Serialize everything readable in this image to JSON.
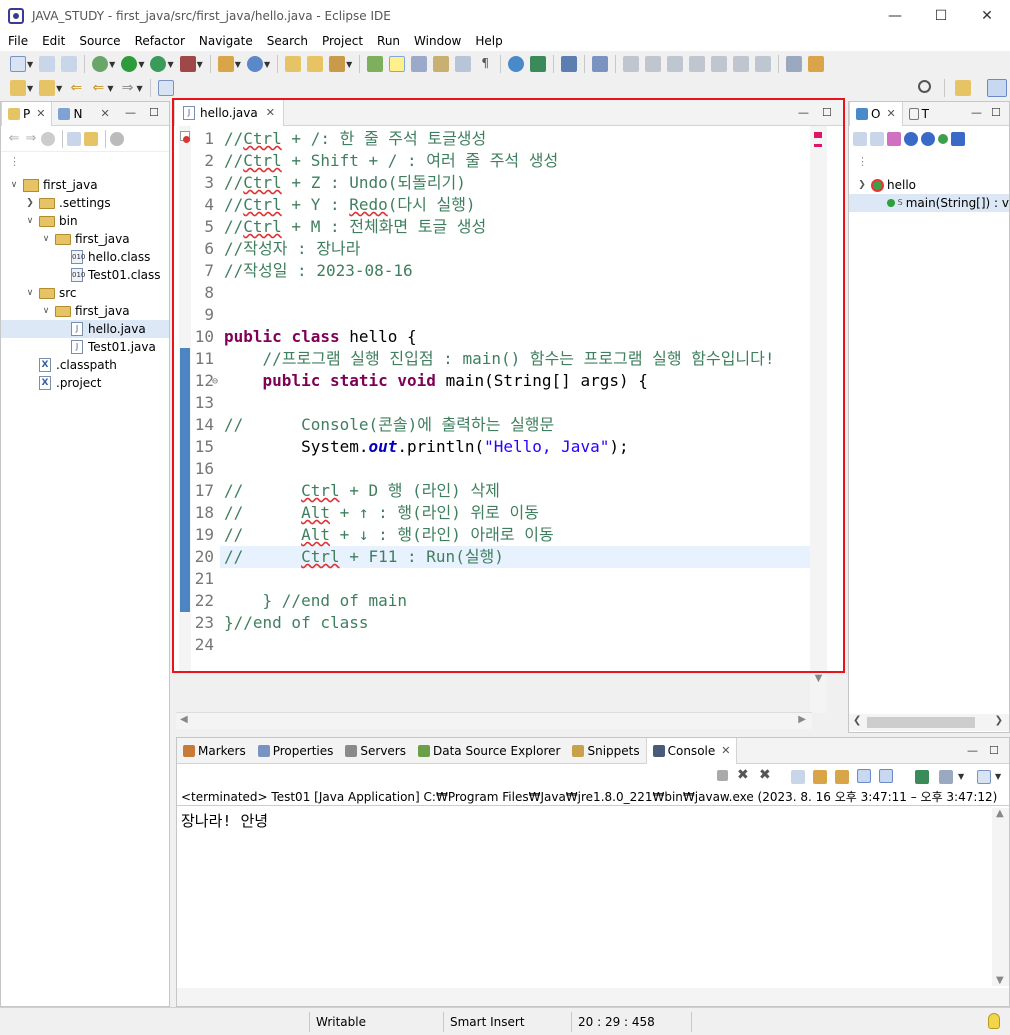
{
  "window": {
    "title": "JAVA_STUDY - first_java/src/first_java/hello.java - Eclipse IDE"
  },
  "menu": [
    "File",
    "Edit",
    "Source",
    "Refactor",
    "Navigate",
    "Search",
    "Project",
    "Run",
    "Window",
    "Help"
  ],
  "left_panel": {
    "tabs": [
      "P",
      "N"
    ],
    "tree": [
      {
        "label": "first_java",
        "type": "project",
        "depth": 0,
        "expanded": true
      },
      {
        "label": ".settings",
        "type": "folder",
        "depth": 1,
        "expanded": false
      },
      {
        "label": "bin",
        "type": "folder",
        "depth": 1,
        "expanded": true
      },
      {
        "label": "first_java",
        "type": "folder",
        "depth": 2,
        "expanded": true
      },
      {
        "label": "hello.class",
        "type": "class",
        "depth": 3
      },
      {
        "label": "Test01.class",
        "type": "class",
        "depth": 3
      },
      {
        "label": "src",
        "type": "folder",
        "depth": 1,
        "expanded": true
      },
      {
        "label": "first_java",
        "type": "folder",
        "depth": 2,
        "expanded": true
      },
      {
        "label": "hello.java",
        "type": "java",
        "depth": 3,
        "selected": true
      },
      {
        "label": "Test01.java",
        "type": "java",
        "depth": 3
      },
      {
        "label": ".classpath",
        "type": "xml",
        "depth": 1
      },
      {
        "label": ".project",
        "type": "xml",
        "depth": 1
      }
    ]
  },
  "editor": {
    "tab": "hello.java",
    "lines": [
      {
        "n": "1",
        "segs": [
          {
            "t": "//",
            "c": "cm"
          },
          {
            "t": "Ctrl",
            "c": "cm ul"
          },
          {
            "t": " + /: 한 줄 주석 토글생성",
            "c": "cm"
          }
        ]
      },
      {
        "n": "2",
        "segs": [
          {
            "t": "//",
            "c": "cm"
          },
          {
            "t": "Ctrl",
            "c": "cm ul"
          },
          {
            "t": " + Shift + / : 여러 줄 주석 생성",
            "c": "cm"
          }
        ]
      },
      {
        "n": "3",
        "segs": [
          {
            "t": "//",
            "c": "cm"
          },
          {
            "t": "Ctrl",
            "c": "cm ul"
          },
          {
            "t": " + Z : Undo(되돌리기)",
            "c": "cm"
          }
        ]
      },
      {
        "n": "4",
        "segs": [
          {
            "t": "//",
            "c": "cm"
          },
          {
            "t": "Ctrl",
            "c": "cm ul"
          },
          {
            "t": " + Y : ",
            "c": "cm"
          },
          {
            "t": "Redo",
            "c": "cm ul"
          },
          {
            "t": "(다시 실행)",
            "c": "cm"
          }
        ]
      },
      {
        "n": "5",
        "segs": [
          {
            "t": "//",
            "c": "cm"
          },
          {
            "t": "Ctrl",
            "c": "cm ul"
          },
          {
            "t": " + M : 전체화면 토글 생성",
            "c": "cm"
          }
        ]
      },
      {
        "n": "6",
        "segs": [
          {
            "t": "//작성자 : 장나라",
            "c": "cm"
          }
        ]
      },
      {
        "n": "7",
        "segs": [
          {
            "t": "//작성일 : 2023-08-16",
            "c": "cm"
          }
        ]
      },
      {
        "n": "8",
        "segs": []
      },
      {
        "n": "9",
        "segs": []
      },
      {
        "n": "10",
        "segs": [
          {
            "t": "public",
            "c": "kw"
          },
          {
            "t": " ",
            "c": "pl"
          },
          {
            "t": "class",
            "c": "kw"
          },
          {
            "t": " hello {",
            "c": "pl"
          }
        ]
      },
      {
        "n": "11",
        "segs": [
          {
            "t": "    //프로그램 실행 진입점 : main() 함수는 프로그램 실행 함수입니다!",
            "c": "cm"
          }
        ]
      },
      {
        "n": "12",
        "segs": [
          {
            "t": "    ",
            "c": "pl"
          },
          {
            "t": "public",
            "c": "kw"
          },
          {
            "t": " ",
            "c": "pl"
          },
          {
            "t": "static",
            "c": "kw"
          },
          {
            "t": " ",
            "c": "pl"
          },
          {
            "t": "void",
            "c": "kw"
          },
          {
            "t": " main(String[] ",
            "c": "pl"
          },
          {
            "t": "args",
            "c": "pl"
          },
          {
            "t": ") {",
            "c": "pl"
          }
        ]
      },
      {
        "n": "13",
        "segs": []
      },
      {
        "n": "14",
        "segs": [
          {
            "t": "//      Console(콘솔)에 출력하는 실행문",
            "c": "cm"
          }
        ]
      },
      {
        "n": "15",
        "segs": [
          {
            "t": "        System.",
            "c": "pl"
          },
          {
            "t": "out",
            "c": "fld"
          },
          {
            "t": ".println(",
            "c": "pl"
          },
          {
            "t": "\"Hello, Java\"",
            "c": "st"
          },
          {
            "t": ");",
            "c": "pl"
          }
        ]
      },
      {
        "n": "16",
        "segs": []
      },
      {
        "n": "17",
        "segs": [
          {
            "t": "//      ",
            "c": "cm"
          },
          {
            "t": "Ctrl",
            "c": "cm ul"
          },
          {
            "t": " + D 행 (라인) 삭제",
            "c": "cm"
          }
        ]
      },
      {
        "n": "18",
        "segs": [
          {
            "t": "//      ",
            "c": "cm"
          },
          {
            "t": "Alt",
            "c": "cm ul"
          },
          {
            "t": " + ↑ : 행(라인) 위로 이동",
            "c": "cm"
          }
        ]
      },
      {
        "n": "19",
        "segs": [
          {
            "t": "//      ",
            "c": "cm"
          },
          {
            "t": "Alt",
            "c": "cm ul"
          },
          {
            "t": " + ↓ : 행(라인) 아래로 이동",
            "c": "cm"
          }
        ]
      },
      {
        "n": "20",
        "segs": [
          {
            "t": "//      ",
            "c": "cm"
          },
          {
            "t": "Ctrl",
            "c": "cm ul"
          },
          {
            "t": " + F11 : Run(실행)",
            "c": "cm"
          }
        ],
        "current": true
      },
      {
        "n": "21",
        "segs": []
      },
      {
        "n": "22",
        "segs": [
          {
            "t": "    } //end of main",
            "c": "cm"
          }
        ]
      },
      {
        "n": "23",
        "segs": [
          {
            "t": "}//end of class",
            "c": "cm"
          }
        ]
      },
      {
        "n": "24",
        "segs": []
      }
    ]
  },
  "outline": {
    "tabs": [
      "O",
      "T"
    ],
    "class_name": "hello",
    "method": "main(String[]) : v"
  },
  "bottom": {
    "tabs": [
      "Markers",
      "Properties",
      "Servers",
      "Data Source Explorer",
      "Snippets",
      "Console"
    ],
    "console_header": "<terminated> Test01 [Java Application] C:₩Program Files₩Java₩jre1.8.0_221₩bin₩javaw.exe  (2023. 8. 16 오후 3:47:11 – 오후 3:47:12)",
    "console_output": "장나라! 안녕"
  },
  "status": {
    "writable": "Writable",
    "insert_mode": "Smart Insert",
    "position": "20 : 29 : 458"
  },
  "colors": {
    "highlight_border": "#e8141b",
    "comment": "#3f7f5f",
    "keyword": "#7f0055",
    "string": "#2a00ff"
  }
}
